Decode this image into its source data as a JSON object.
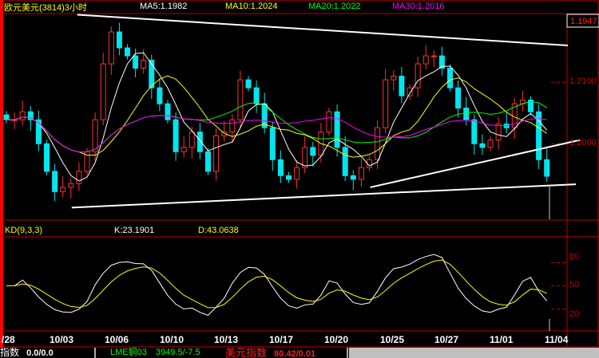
{
  "header": {
    "title": "欧元美元(3814)3小时",
    "ma5": "MA5:1.1982",
    "ma10": "MA10:1.2024",
    "ma20": "MA20:1.2022",
    "ma30": "MA30:1.2016"
  },
  "indicator": {
    "name": "KD(9,3,3)",
    "k": "K:23.1901",
    "d": "D:43.0638"
  },
  "status_bar": [
    {
      "label": "指数",
      "value": "0.0/0.0"
    },
    {
      "label": "LME铜03",
      "value": "3949.5/-7.5"
    },
    {
      "label": "美元指数",
      "value": "80.42/0.01"
    }
  ],
  "colors": {
    "up": "#ff3232",
    "down": "#00e5ee",
    "ma5": "#ffffff",
    "ma10": "#ffff00",
    "ma20": "#00ff00",
    "ma30": "#ff00ff",
    "axis": "#c00000",
    "trendline": "#ffffff"
  },
  "chart_data": [
    {
      "type": "candlestick",
      "title": "欧元美元(3814)3小时",
      "current_price": "1.1947",
      "y_ticks": [
        "1.2100",
        "1.2000"
      ],
      "ylim": [
        1.1877,
        1.2208
      ],
      "x_tick_labels": [
        "/28",
        "10/03",
        "10/06",
        "10/10",
        "10/13",
        "10/17",
        "10/20",
        "10/25",
        "10/27",
        "11/01",
        "11/04"
      ],
      "close": [
        1.2039,
        1.2039,
        1.2052,
        1.2039,
        1.2,
        1.1955,
        1.1922,
        1.1929,
        1.1935,
        1.1955,
        1.1987,
        1.2039,
        1.213,
        1.2182,
        1.2156,
        1.2143,
        1.2123,
        1.2136,
        1.2091,
        1.2065,
        1.2039,
        1.1987,
        1.1994,
        1.2019,
        1.1987,
        1.1955,
        1.2013,
        1.2019,
        1.2039,
        1.2104,
        1.2091,
        1.2065,
        1.2026,
        1.1974,
        1.1948,
        1.1942,
        1.1961,
        1.1994,
        1.1981,
        1.2019,
        1.2052,
        1.1994,
        1.1948,
        1.1942,
        1.1961,
        1.1974,
        1.2026,
        1.2104,
        1.211,
        1.2078,
        1.2091,
        1.213,
        1.2143,
        1.2143,
        1.2123,
        1.2091,
        1.2058,
        1.2039,
        1.2,
        1.1994,
        1.2006,
        1.2032,
        1.2026,
        1.2065,
        1.2071,
        1.2052,
        1.1974,
        1.1947
      ],
      "moving_averages": [
        5,
        10,
        20,
        30
      ],
      "trendlines": [
        {
          "from": [
            8.8,
            1.221
          ],
          "to": [
            69.6,
            1.216
          ]
        },
        {
          "from": [
            8.1,
            1.1896
          ],
          "to": [
            70.6,
            1.1934
          ]
        },
        {
          "from": [
            45.1,
            1.1929
          ],
          "to": [
            71.1,
            1.2006
          ]
        }
      ]
    },
    {
      "type": "line",
      "title": "KD(9,3,3)",
      "y_ticks": [
        "80",
        "50",
        "20"
      ],
      "ylim": [
        0,
        100
      ],
      "series": [
        {
          "name": "K"
        },
        {
          "name": "D"
        }
      ]
    }
  ]
}
